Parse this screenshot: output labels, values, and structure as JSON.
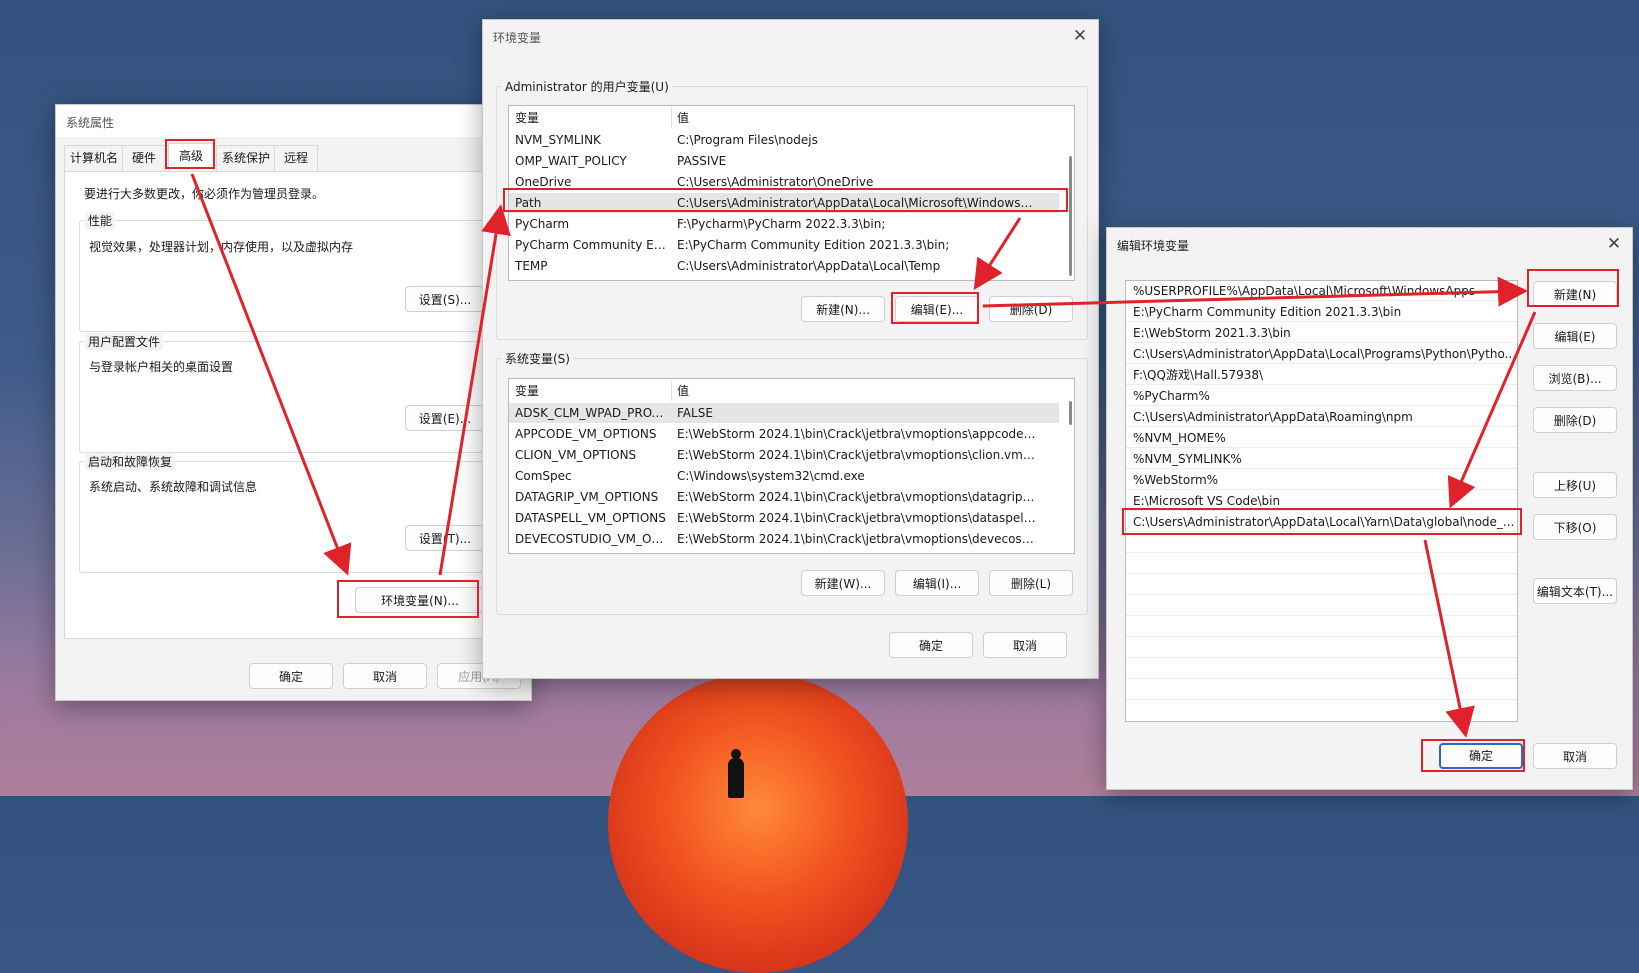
{
  "sys_props": {
    "title": "系统属性",
    "tabs": [
      "计算机名",
      "硬件",
      "高级",
      "系统保护",
      "远程"
    ],
    "admin_note": "要进行大多数更改，你必须作为管理员登录。",
    "perf": {
      "label": "性能",
      "desc": "视觉效果，处理器计划，内存使用，以及虚拟内存",
      "button": "设置(S)..."
    },
    "profile": {
      "label": "用户配置文件",
      "desc": "与登录帐户相关的桌面设置",
      "button": "设置(E)..."
    },
    "startup": {
      "label": "启动和故障恢复",
      "desc": "系统启动、系统故障和调试信息",
      "button": "设置(T)..."
    },
    "env_button": "环境变量(N)...",
    "ok": "确定",
    "cancel": "取消",
    "apply": "应用(A)"
  },
  "env_vars": {
    "title": "环境变量",
    "user_group": "Administrator 的用户变量(U)",
    "col_var": "变量",
    "col_val": "值",
    "user_rows": [
      {
        "name": "NVM_SYMLINK",
        "value": "C:\\Program Files\\nodejs"
      },
      {
        "name": "OMP_WAIT_POLICY",
        "value": "PASSIVE"
      },
      {
        "name": "OneDrive",
        "value": "C:\\Users\\Administrator\\OneDrive"
      },
      {
        "name": "Path",
        "value": "C:\\Users\\Administrator\\AppData\\Local\\Microsoft\\WindowsA..."
      },
      {
        "name": "PyCharm",
        "value": "F:\\Pycharm\\PyCharm 2022.3.3\\bin;"
      },
      {
        "name": "PyCharm Community Editi...",
        "value": "E:\\PyCharm Community Edition 2021.3.3\\bin;"
      },
      {
        "name": "TEMP",
        "value": "C:\\Users\\Administrator\\AppData\\Local\\Temp"
      }
    ],
    "user_buttons": {
      "new": "新建(N)...",
      "edit": "编辑(E)...",
      "delete": "删除(D)"
    },
    "sys_group": "系统变量(S)",
    "sys_rows": [
      {
        "name": "ADSK_CLM_WPAD_PROXY...",
        "value": "FALSE"
      },
      {
        "name": "APPCODE_VM_OPTIONS",
        "value": "E:\\WebStorm 2024.1\\bin\\Crack\\jetbra\\vmoptions\\appcode.v..."
      },
      {
        "name": "CLION_VM_OPTIONS",
        "value": "E:\\WebStorm 2024.1\\bin\\Crack\\jetbra\\vmoptions\\clion.vmopt..."
      },
      {
        "name": "ComSpec",
        "value": "C:\\Windows\\system32\\cmd.exe"
      },
      {
        "name": "DATAGRIP_VM_OPTIONS",
        "value": "E:\\WebStorm 2024.1\\bin\\Crack\\jetbra\\vmoptions\\datagrip.v..."
      },
      {
        "name": "DATASPELL_VM_OPTIONS",
        "value": "E:\\WebStorm 2024.1\\bin\\Crack\\jetbra\\vmoptions\\dataspell.v..."
      },
      {
        "name": "DEVECOSTUDIO_VM_OPT...",
        "value": "E:\\WebStorm 2024.1\\bin\\Crack\\jetbra\\vmoptions\\devecostud..."
      }
    ],
    "sys_buttons": {
      "new": "新建(W)...",
      "edit": "编辑(I)...",
      "delete": "删除(L)"
    },
    "ok": "确定",
    "cancel": "取消"
  },
  "edit_env": {
    "title": "编辑环境变量",
    "items": [
      "%USERPROFILE%\\AppData\\Local\\Microsoft\\WindowsApps",
      "E:\\PyCharm Community Edition 2021.3.3\\bin",
      "E:\\WebStorm 2021.3.3\\bin",
      "C:\\Users\\Administrator\\AppData\\Local\\Programs\\Python\\Pytho...",
      "F:\\QQ游戏\\Hall.57938\\",
      "%PyCharm%",
      "C:\\Users\\Administrator\\AppData\\Roaming\\npm",
      "%NVM_HOME%",
      "%NVM_SYMLINK%",
      "%WebStorm%",
      "E:\\Microsoft VS Code\\bin",
      "C:\\Users\\Administrator\\AppData\\Local\\Yarn\\Data\\global\\node_..."
    ],
    "buttons": {
      "new": "新建(N)",
      "edit": "编辑(E)",
      "browse": "浏览(B)...",
      "delete": "删除(D)",
      "up": "上移(U)",
      "down": "下移(O)",
      "edit_text": "编辑文本(T)..."
    },
    "ok": "确定",
    "cancel": "取消"
  },
  "colors": {
    "highlight": "#e0232a",
    "focus": "#2b66c9"
  }
}
